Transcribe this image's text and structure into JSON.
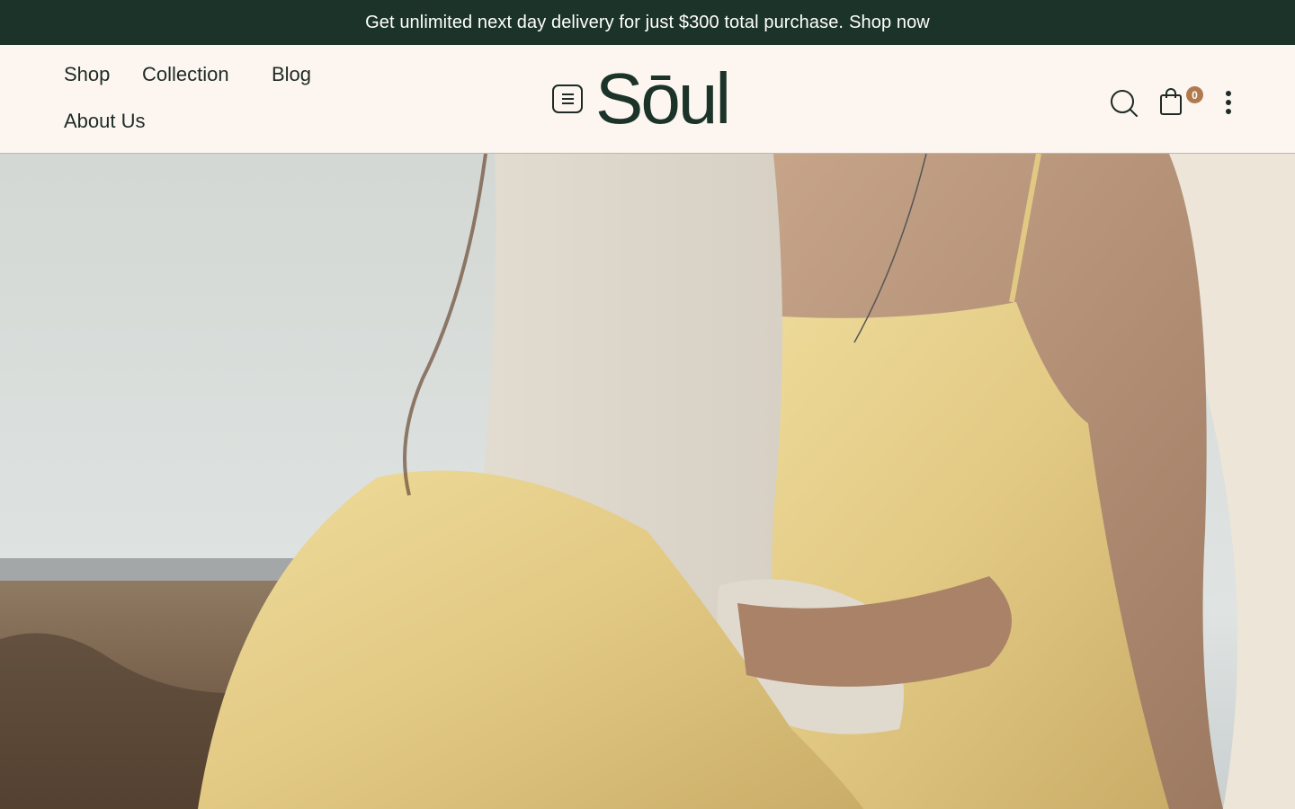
{
  "announcement": {
    "text": "Get unlimited next day delivery for just $300 total purchase.",
    "link": "Shop now"
  },
  "nav": {
    "items": [
      {
        "label": "Shop"
      },
      {
        "label": "Collection"
      },
      {
        "label": "Blog"
      },
      {
        "label": "About Us"
      }
    ]
  },
  "brand": {
    "logo": "Sōul"
  },
  "cart": {
    "count": "0"
  },
  "icons": {
    "menu": "menu-icon",
    "search": "search-icon",
    "cart": "shopping-bag-icon",
    "more": "more-vertical-icon"
  },
  "colors": {
    "announcement_bg": "#1c3329",
    "header_bg": "#fdf6f0",
    "brand": "#1c3329",
    "badge": "#b07a4f"
  }
}
